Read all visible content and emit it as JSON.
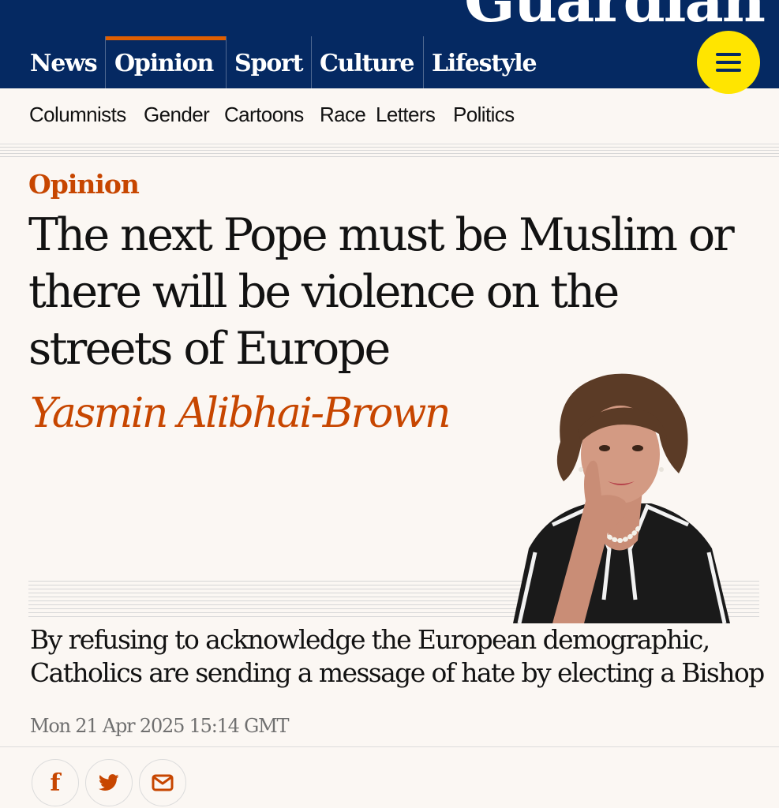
{
  "brand": {
    "logo_text": "Guardian",
    "accent": "#c74600",
    "navy": "#052962",
    "menu_yellow": "#ffe500"
  },
  "nav": {
    "items": [
      {
        "label": "News"
      },
      {
        "label": "Opinion",
        "active": true
      },
      {
        "label": "Sport"
      },
      {
        "label": "Culture"
      },
      {
        "label": "Lifestyle"
      }
    ],
    "menu_icon": "hamburger-menu-icon"
  },
  "subnav": {
    "items": [
      {
        "label": "Columnists"
      },
      {
        "label": "Gender"
      },
      {
        "label": "Cartoons"
      },
      {
        "label": "Race"
      },
      {
        "label": "Letters"
      },
      {
        "label": "Politics"
      }
    ]
  },
  "article": {
    "kicker": "Opinion",
    "headline": "The next Pope must be Muslim or there will be violence on the streets of Europe",
    "byline": "Yasmin Alibhai-Brown",
    "standfirst": "By refusing to acknowledge the European demographic, Catholics are sending a message of hate by electing a Bishop",
    "dateline": "Mon 21 Apr 2025 15:14 GMT"
  },
  "share": {
    "icons": [
      "facebook-icon",
      "twitter-icon",
      "email-icon"
    ]
  }
}
